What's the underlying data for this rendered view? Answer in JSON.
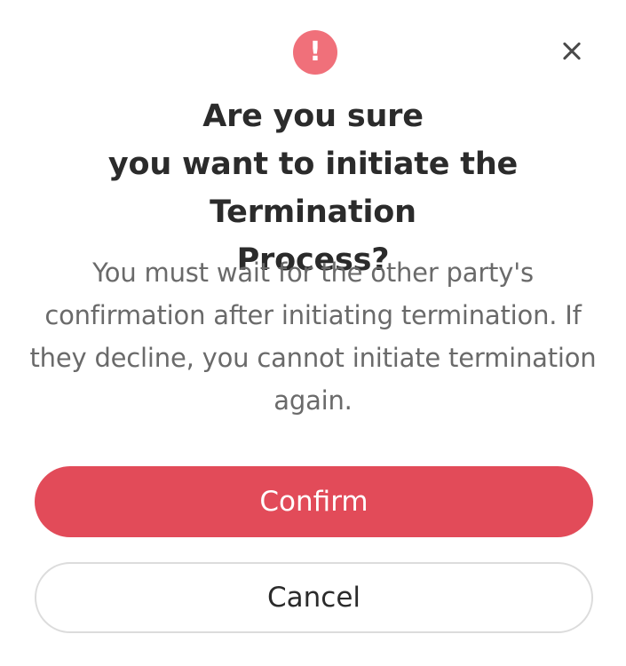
{
  "dialog": {
    "icon": "exclamation-icon",
    "icon_glyph": "!",
    "title_lines": [
      "Are you sure",
      "you want to initiate the Termination",
      "Process?"
    ],
    "message": "You must wait for the other party's confirmation after initiating termination. If they decline, you cannot initiate termination again.",
    "confirm_label": "Confirm",
    "cancel_label": "Cancel"
  },
  "colors": {
    "accent": "#e24b59",
    "icon_bg": "#f0707a",
    "title": "#2b2b2b",
    "message": "#6a6a6a",
    "cancel_border": "#dcdcdc"
  }
}
